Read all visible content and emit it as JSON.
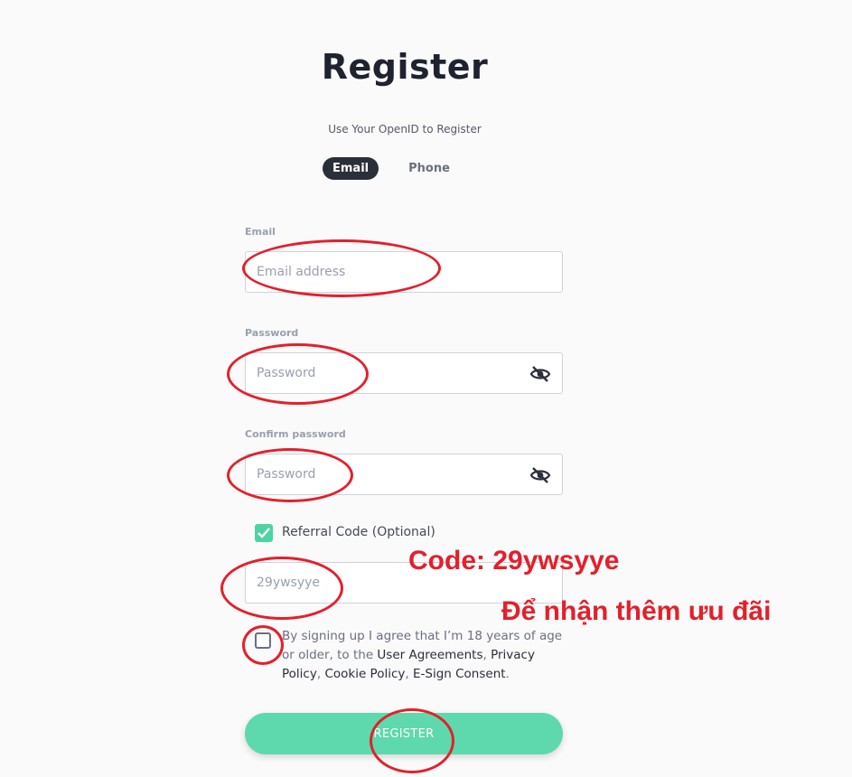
{
  "header": {
    "title": "Register",
    "subtitle": "Use Your OpenID to Register"
  },
  "tabs": [
    {
      "label": "Email",
      "active": true
    },
    {
      "label": "Phone",
      "active": false
    }
  ],
  "form": {
    "email": {
      "label": "Email",
      "placeholder": "Email address",
      "value": ""
    },
    "password": {
      "label": "Password",
      "placeholder": "Password",
      "value": "",
      "icon": "eye-off-icon"
    },
    "confirm_password": {
      "label": "Confirm password",
      "placeholder": "Password",
      "value": "",
      "icon": "eye-off-icon"
    },
    "referral": {
      "checked": true,
      "label": "Referral Code (Optional)",
      "placeholder": "29ywsyye",
      "value": ""
    },
    "agreement": {
      "checked": false,
      "text_before": "By signing up I agree that I’m 18 years of age or older, to the ",
      "link1": "User Agreements",
      "sep1": ", ",
      "link2": "Privacy Policy",
      "sep2": ", ",
      "link3": "Cookie Policy",
      "sep3": ", ",
      "link4": "E-Sign Consent",
      "text_after": "."
    },
    "submit_label": "REGISTER"
  },
  "annotations": {
    "code_note": "Code: 29ywsyye",
    "promo_note": "Để nhận thêm ưu đãi",
    "color": "#e3202b"
  },
  "colors": {
    "accent": "#5ed9ad",
    "tab_active": "#2b2f3a"
  }
}
